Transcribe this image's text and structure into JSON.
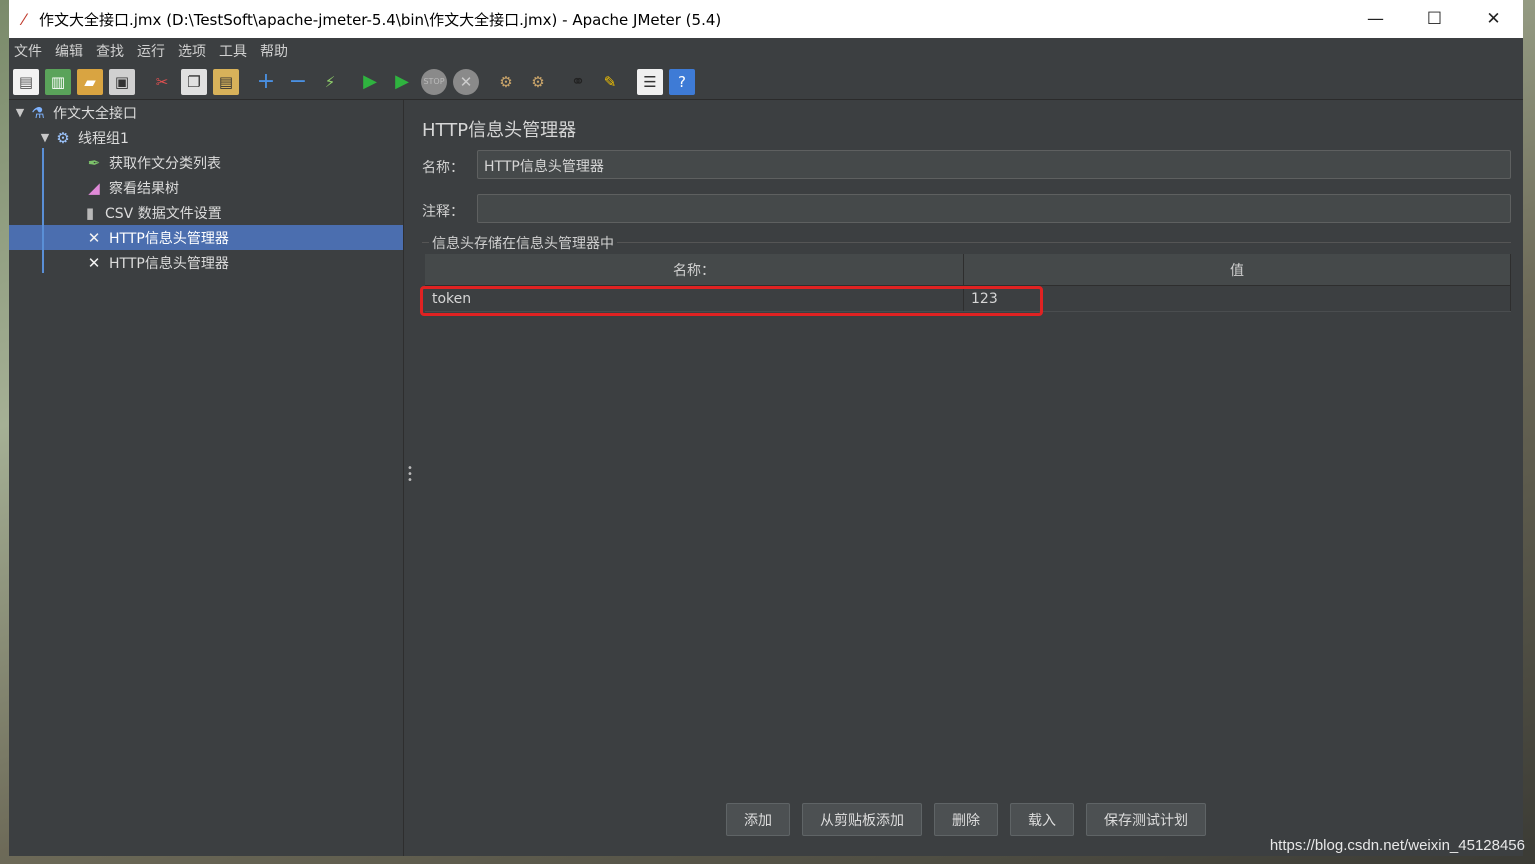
{
  "window": {
    "title": "作文大全接口.jmx (D:\\TestSoft\\apache-jmeter-5.4\\bin\\作文大全接口.jmx) - Apache JMeter (5.4)",
    "minimize": "—",
    "maximize": "☐",
    "close": "✕"
  },
  "menu": [
    "文件",
    "编辑",
    "查找",
    "运行",
    "选项",
    "工具",
    "帮助"
  ],
  "toolbar": {
    "icons": [
      "new-icon",
      "templates-icon",
      "open-icon",
      "save-icon",
      "cut-icon",
      "copy-icon",
      "paste-icon",
      "expand-icon",
      "collapse-icon",
      "toggle-icon",
      "start-icon",
      "start-no-pause-icon",
      "stop-icon",
      "shutdown-icon",
      "clear-icon",
      "clear-all-icon",
      "search-icon",
      "reset-search-icon",
      "function-helper-icon",
      "help-icon"
    ]
  },
  "tree": {
    "root": "作文大全接口",
    "thread_group": "线程组1",
    "children": [
      {
        "label": "获取作文分类列表",
        "icon": "sampler-icon"
      },
      {
        "label": "察看结果树",
        "icon": "listener-icon"
      },
      {
        "label": "CSV 数据文件设置",
        "icon": "config-icon"
      },
      {
        "label": "HTTP信息头管理器",
        "icon": "header-manager-icon",
        "selected": true
      },
      {
        "label": "HTTP信息头管理器",
        "icon": "header-manager-icon"
      }
    ]
  },
  "editor": {
    "title": "HTTP信息头管理器",
    "name_label": "名称：",
    "name_value": "HTTP信息头管理器",
    "comment_label": "注释：",
    "comment_value": "",
    "group_title": "信息头存储在信息头管理器中",
    "table": {
      "columns": [
        "名称：",
        "值"
      ],
      "rows": [
        [
          "token",
          "123"
        ]
      ]
    },
    "buttons": [
      "添加",
      "从剪贴板添加",
      "删除",
      "载入",
      "保存测试计划"
    ]
  },
  "watermark": "https://blog.csdn.net/weixin_45128456"
}
